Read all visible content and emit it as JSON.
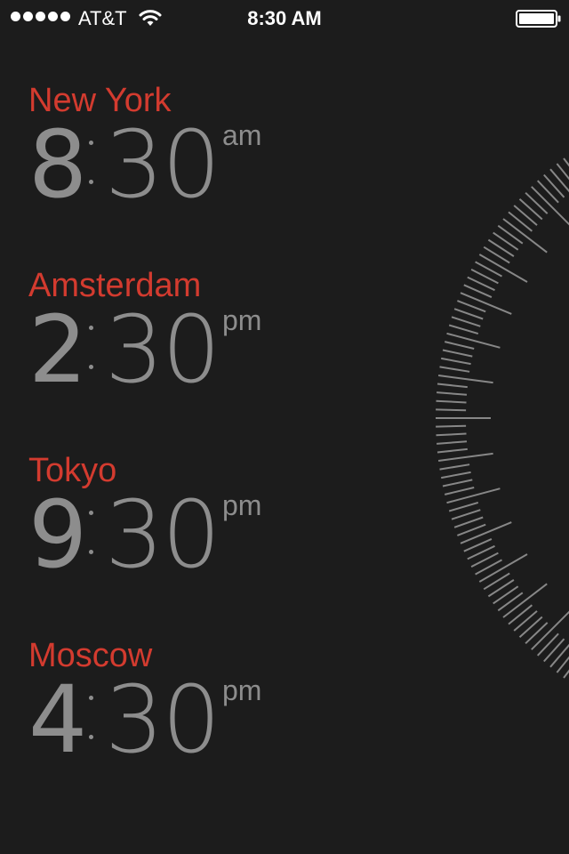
{
  "status_bar": {
    "carrier": "AT&T",
    "time": "8:30 AM",
    "signal_bars": 5,
    "battery_level": 1.0
  },
  "cities": [
    {
      "name": "New York",
      "hour": "8",
      "minutes": "30",
      "meridiem": "am"
    },
    {
      "name": "Amsterdam",
      "hour": "2",
      "minutes": "30",
      "meridiem": "pm"
    },
    {
      "name": "Tokyo",
      "hour": "9",
      "minutes": "30",
      "meridiem": "pm"
    },
    {
      "name": "Moscow",
      "hour": "4",
      "minutes": "30",
      "meridiem": "pm"
    }
  ],
  "colors": {
    "background": "#1c1c1c",
    "city_name": "#d33b2f",
    "time_text": "#8d8d8d",
    "dial_ticks": "#9a9a9a"
  }
}
